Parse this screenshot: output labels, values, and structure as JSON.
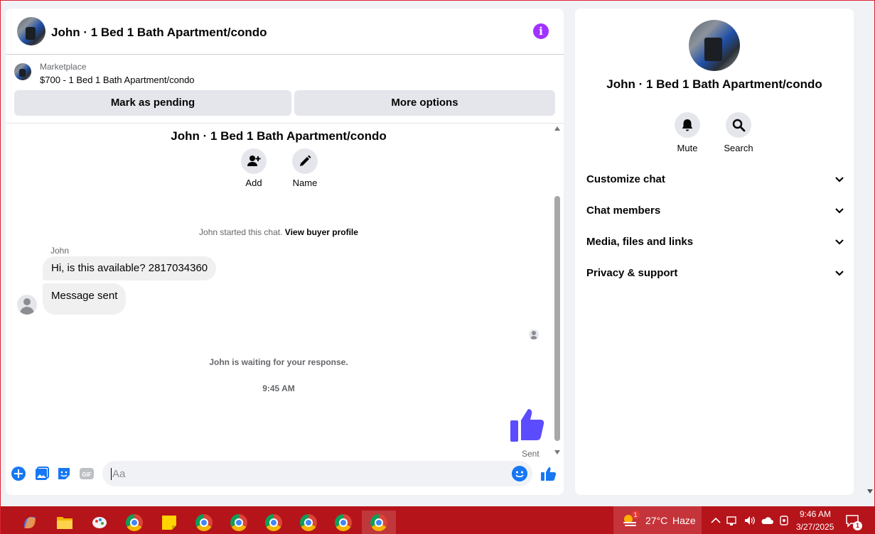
{
  "chat": {
    "title": "John · 1 Bed 1 Bath Apartment/condo",
    "marketplace_label": "Marketplace",
    "listing_price_title": "$700 - 1 Bed 1 Bath Apartment/condo",
    "mark_pending_label": "Mark as pending",
    "more_options_label": "More options",
    "conv_title": "John · 1 Bed 1 Bath Apartment/condo",
    "add_label": "Add",
    "name_label": "Name",
    "started_text": "John started this chat.",
    "buyer_profile_link": "View buyer profile",
    "sender_name": "John",
    "message_1": "Hi, is this available? 2817034360",
    "message_2": "Message sent",
    "waiting_text": "John is waiting for your response.",
    "time_stamp": "9:45 AM",
    "sent_label": "Sent",
    "input_placeholder": "Aa"
  },
  "info": {
    "title": "John · 1 Bed 1 Bath Apartment/condo",
    "mute_label": "Mute",
    "search_label": "Search",
    "sections": [
      "Customize chat",
      "Chat members",
      "Media, files and links",
      "Privacy & support"
    ]
  },
  "taskbar": {
    "weather_badge": "1",
    "temperature": "27°C",
    "condition": "Haze",
    "time": "9:46 AM",
    "date": "3/27/2025",
    "notification_count": "1"
  },
  "colors": {
    "accent": "#1877f2",
    "info_purple": "#a033ff",
    "thumb_purple": "#5b4cff",
    "taskbar": "#b5141a"
  }
}
